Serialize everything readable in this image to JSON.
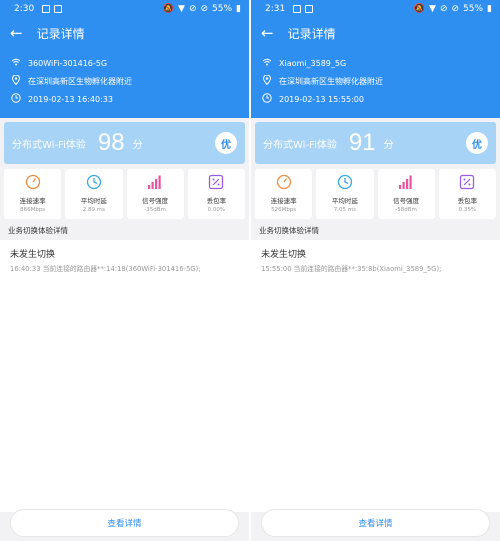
{
  "screens": [
    {
      "status": {
        "time": "2:30",
        "battery": "55%"
      },
      "header": {
        "title": "记录详情"
      },
      "info": {
        "ssid": "360WiFi-301416-5G",
        "location": "在深圳高新区生物孵化器附近",
        "datetime": "2019-02-13 16:40:33"
      },
      "score": {
        "label": "分布式Wi-Fi体验",
        "value": "98",
        "unit": "分",
        "grade": "优"
      },
      "metrics": [
        {
          "icon": "speedometer-icon",
          "label": "连接速率",
          "value": "866Mbps"
        },
        {
          "icon": "clock-icon",
          "label": "平均时延",
          "value": "2.89 ms"
        },
        {
          "icon": "signal-bars-icon",
          "label": "信号强度",
          "value": "-35dBm"
        },
        {
          "icon": "percent-icon",
          "label": "丢包率",
          "value": "0.00%"
        }
      ],
      "section_title": "业务切换体验详情",
      "switch": {
        "title": "未发生切换",
        "detail": "16:40:33 当前连接的路由器**:14:18(360WiFi-301416-5G);"
      },
      "bottom_button": "查看详情"
    },
    {
      "status": {
        "time": "2:31",
        "battery": "55%"
      },
      "header": {
        "title": "记录详情"
      },
      "info": {
        "ssid": "Xiaomi_3589_5G",
        "location": "在深圳高新区生物孵化器附近",
        "datetime": "2019-02-13 15:55:00"
      },
      "score": {
        "label": "分布式Wi-Fi体验",
        "value": "91",
        "unit": "分",
        "grade": "优"
      },
      "metrics": [
        {
          "icon": "speedometer-icon",
          "label": "连接速率",
          "value": "526Mbps"
        },
        {
          "icon": "clock-icon",
          "label": "平均时延",
          "value": "7.05 ms"
        },
        {
          "icon": "signal-bars-icon",
          "label": "信号强度",
          "value": "-58dBm"
        },
        {
          "icon": "percent-icon",
          "label": "丢包率",
          "value": "0.35%"
        }
      ],
      "section_title": "业务切换体验详情",
      "switch": {
        "title": "未发生切换",
        "detail": "15:55:00 当前连接的路由器**:35:8b(Xiaomi_3589_5G);"
      },
      "bottom_button": "查看详情"
    }
  ],
  "colors": {
    "primary": "#2f8ff0",
    "score_card": "#a7d3f6",
    "speed": "#f08a3c",
    "latency": "#3aa7e8",
    "signal": "#e9559a",
    "loss": "#9a5ce0"
  }
}
